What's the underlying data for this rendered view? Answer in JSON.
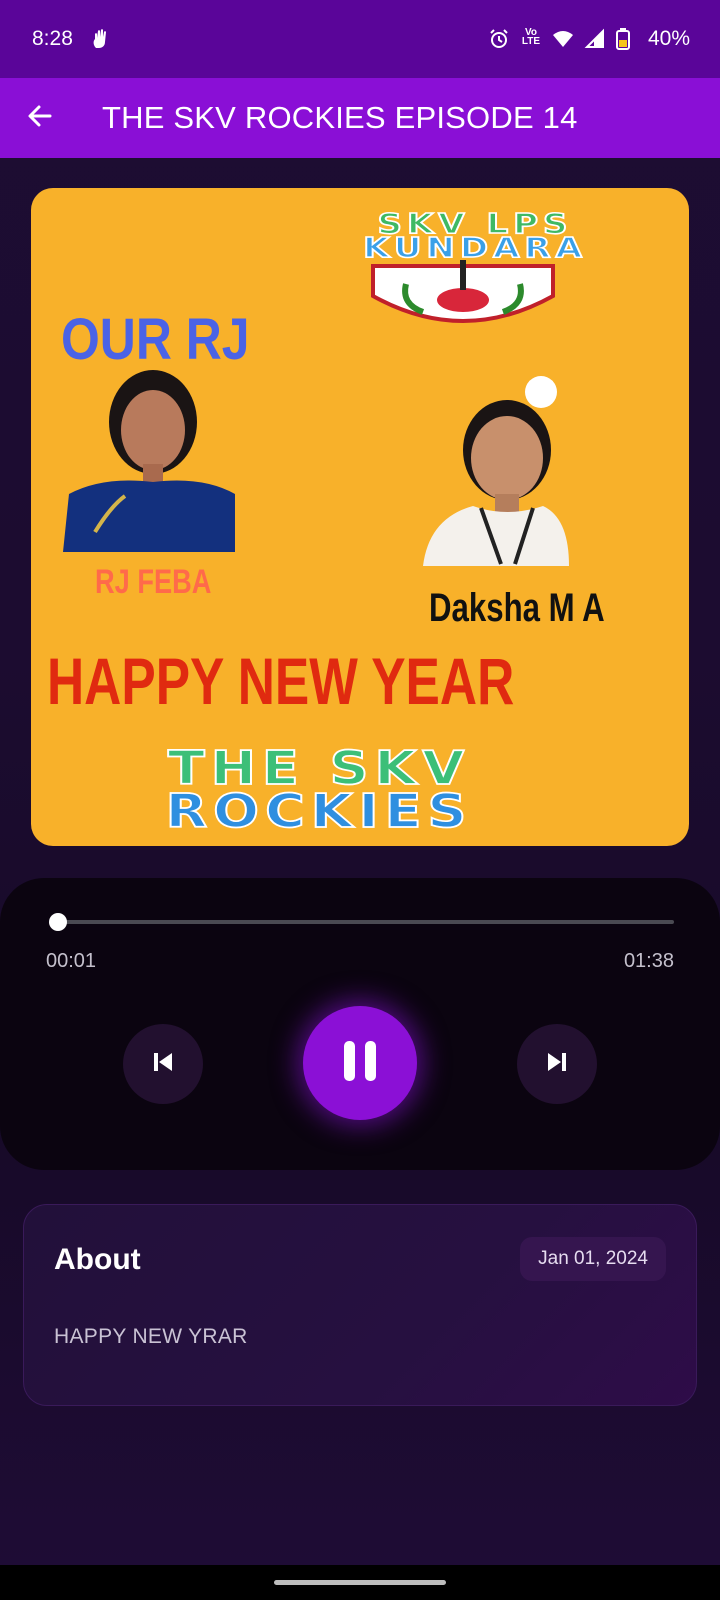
{
  "status_bar": {
    "time": "8:28",
    "battery": "40%",
    "icons": [
      "hand-gesture-icon",
      "alarm-icon",
      "volte-icon",
      "wifi-icon",
      "signal-icon",
      "battery-icon"
    ]
  },
  "app_bar": {
    "title": "THE SKV ROCKIES EPISODE 14",
    "back_icon": "arrow-left-icon"
  },
  "artwork": {
    "school_line1": "SKV LPS",
    "school_line2": "KUNDARA",
    "emblem_text": "S.K.V.L.P.S.KUNDARA",
    "our_rj": "OUR RJ",
    "rj_name": "RJ FEBA",
    "guest_name": "Daksha M A",
    "greeting": "HAPPY NEW YEAR",
    "show_line1": "THE SKV",
    "show_line2": "ROCKIES"
  },
  "player": {
    "current_time": "00:01",
    "total_time": "01:38",
    "progress": 0.01,
    "state": "playing",
    "prev_icon": "skip-previous-icon",
    "pause_icon": "pause-icon",
    "next_icon": "skip-next-icon",
    "accent": "#8b10d6"
  },
  "about": {
    "title": "About",
    "date": "Jan 01, 2024",
    "description": "HAPPY NEW YRAR"
  }
}
